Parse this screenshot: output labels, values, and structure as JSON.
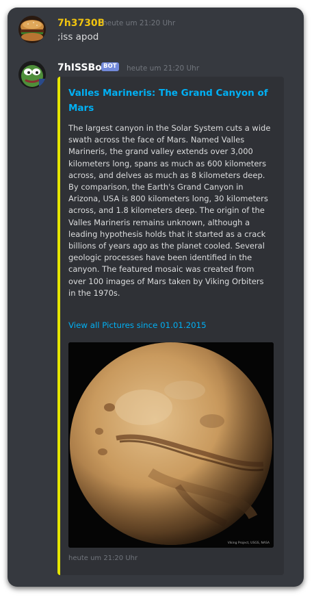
{
  "messages": [
    {
      "username": "7h3730B",
      "username_color": "#f1c40f",
      "timestamp": "heute um 21:20 Uhr",
      "content": ";iss apod"
    },
    {
      "username": "7hISSBot",
      "username_color": "#ffffff",
      "badge": "BOT",
      "timestamp": "heute um 21:20 Uhr",
      "embed": {
        "accent_color": "#e6e600",
        "title": "Valles Marineris: The Grand Canyon of Mars",
        "description": "The largest canyon in the Solar System cuts a wide\nswath across the face of Mars. Named Valles\nMarineris, the grand valley extends over 3,000\nkilometers long, spans as much as 600 kilometers\nacross, and delves as much as 8 kilometers deep.\nBy comparison, the Earth's Grand Canyon in\nArizona, USA is 800 kilometers long, 30 kilometers\nacross, and 1.8 kilometers deep. The origin of the\nValles Marineris remains unknown, although a\nleading hypothesis holds that it started as a crack\nbillions of years ago as the planet cooled. Several\ngeologic processes have been identified in the\ncanyon. The featured mosaic was created from\nover 100 images of Mars taken by Viking Orbiters\nin the 1970s.",
        "link_text": "View all Pictures since 01.01.2015",
        "image_credit": "Viking Project, USGS, NASA",
        "footer_timestamp": "heute um 21:20 Uhr"
      }
    }
  ],
  "colors": {
    "background": "#36393f",
    "embed_background": "#2f3136",
    "link": "#00b0f4",
    "muted_text": "#72767d",
    "bot_badge": "#7289da"
  }
}
